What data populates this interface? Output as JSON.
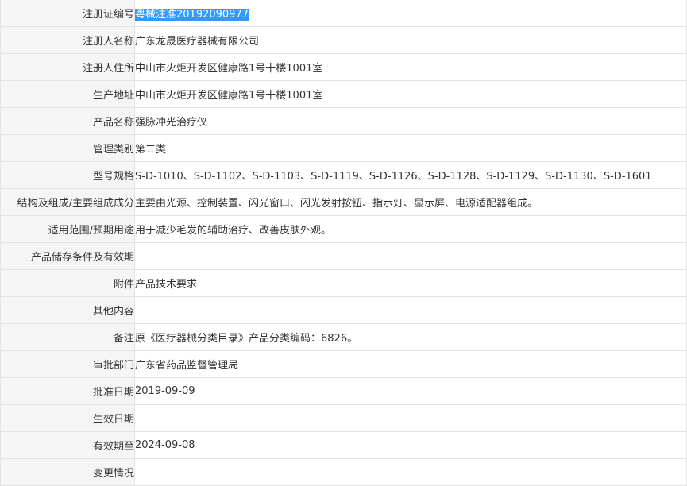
{
  "rows": [
    {
      "label": "注册证编号",
      "value": "粤械注准20192090977"
    },
    {
      "label": "注册人名称",
      "value": "广东龙晟医疗器械有限公司"
    },
    {
      "label": "注册人住所",
      "value": "中山市火炬开发区健康路1号十楼1001室"
    },
    {
      "label": "生产地址",
      "value": "中山市火炬开发区健康路1号十楼1001室"
    },
    {
      "label": "产品名称",
      "value": "强脉冲光治疗仪"
    },
    {
      "label": "管理类别",
      "value": "第二类"
    },
    {
      "label": "型号规格",
      "value": "S-D-1010、S-D-1102、S-D-1103、S-D-1119、S-D-1126、S-D-1128、S-D-1129、S-D-1130、S-D-1601"
    },
    {
      "label": "结构及组成/主要组成成分",
      "value": "主要由光源、控制装置、闪光窗口、闪光发射按钮、指示灯、显示屏、电源适配器组成。"
    },
    {
      "label": "适用范围/预期用途",
      "value": "用于减少毛发的辅助治疗、改善皮肤外观。"
    },
    {
      "label": "产品储存条件及有效期",
      "value": ""
    },
    {
      "label": "附件",
      "value": "产品技术要求"
    },
    {
      "label": "其他内容",
      "value": ""
    },
    {
      "label": "备注",
      "value": "原《医疗器械分类目录》产品分类编码：6826。"
    },
    {
      "label": "审批部门",
      "value": "广东省药品监督管理局"
    },
    {
      "label": "批准日期",
      "value": "2019-09-09"
    },
    {
      "label": "生效日期",
      "value": ""
    },
    {
      "label": "有效期至",
      "value": "2024-09-08"
    },
    {
      "label": "变更情况",
      "value": ""
    }
  ],
  "colors": {
    "label_bg": "#f5f5f5",
    "border": "#e3e3e3",
    "text": "#333333",
    "selection_bg": "#3399ff",
    "selection_text": "#ffffff"
  }
}
